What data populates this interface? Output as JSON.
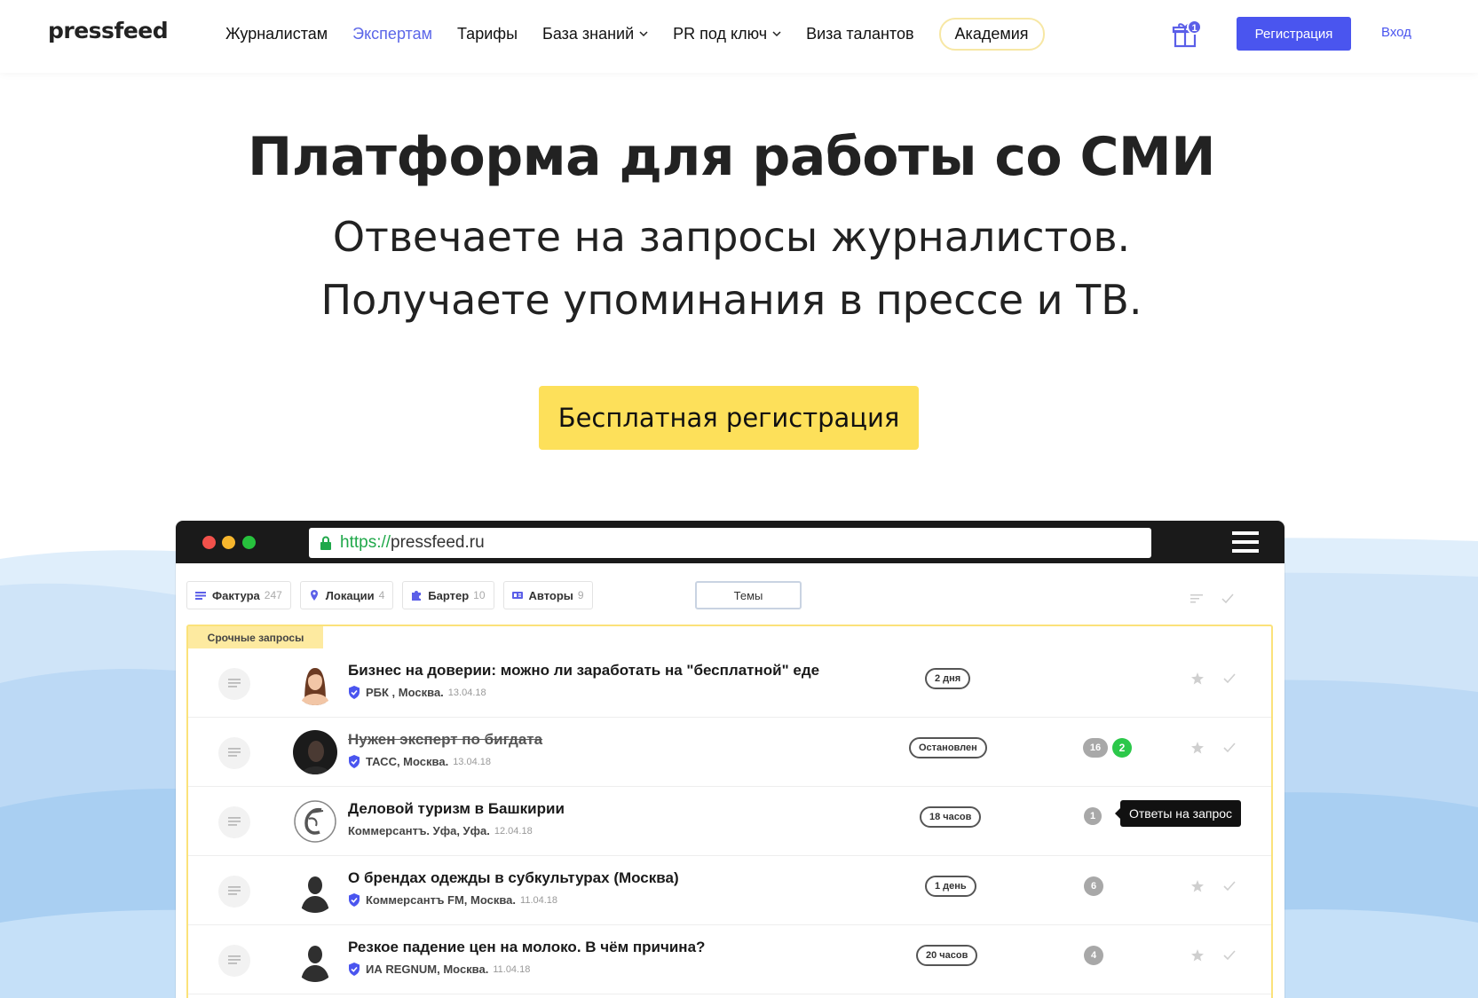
{
  "header": {
    "logo": "pressfeed",
    "nav": [
      {
        "label": "Журналистам",
        "active": false,
        "dropdown": false
      },
      {
        "label": "Экспертам",
        "active": true,
        "dropdown": false
      },
      {
        "label": "Тарифы",
        "active": false,
        "dropdown": false
      },
      {
        "label": "База знаний",
        "active": false,
        "dropdown": true
      },
      {
        "label": "PR под ключ",
        "active": false,
        "dropdown": true
      },
      {
        "label": "Виза талантов",
        "active": false,
        "dropdown": false
      },
      {
        "label": "Академия",
        "active": false,
        "dropdown": false
      }
    ],
    "gift_badge": "1",
    "register_label": "Регистрация",
    "login_label": "Вход"
  },
  "hero": {
    "title": "Платформа для работы со СМИ",
    "subtitle_line1": "Отвечаете на запросы журналистов.",
    "subtitle_line2": "Получаете упоминания в прессе и ТВ.",
    "cta_label": "Бесплатная регистрация"
  },
  "browser": {
    "url_protocol": "https://",
    "url_host": "pressfeed.ru",
    "filters": [
      {
        "label": "Фактура",
        "count": "247",
        "icon": "list-icon"
      },
      {
        "label": "Локации",
        "count": "4",
        "icon": "location-pin-icon"
      },
      {
        "label": "Бартер",
        "count": "10",
        "icon": "puzzle-icon"
      },
      {
        "label": "Авторы",
        "count": "9",
        "icon": "id-card-icon"
      }
    ],
    "themes_label": "Темы",
    "urgent_label": "Срочные запросы",
    "tooltip": "Ответы на запрос",
    "requests": [
      {
        "title": "Бизнес на доверии: можно ли заработать на \"бесплатной\" еде",
        "source": "РБК , Москва.",
        "date": "13.04.18",
        "deadline": "2 дня",
        "verified": true,
        "stopped": false,
        "answers": "",
        "new_answers": ""
      },
      {
        "title": "Нужен эксперт по бигдата",
        "source": "ТАСС, Москва.",
        "date": "13.04.18",
        "deadline": "Остановлен",
        "verified": true,
        "stopped": true,
        "answers": "16",
        "new_answers": "2"
      },
      {
        "title": "Деловой туризм в Башкирии",
        "source": "Коммерсантъ. Уфа, Уфа.",
        "date": "12.04.18",
        "deadline": "18 часов",
        "verified": false,
        "stopped": false,
        "answers": "1",
        "new_answers": ""
      },
      {
        "title": "О брендах одежды в субкультурах (Москва)",
        "source": "Коммерсантъ FM, Москва.",
        "date": "11.04.18",
        "deadline": "1 день",
        "verified": true,
        "stopped": false,
        "answers": "6",
        "new_answers": ""
      },
      {
        "title": "Резкое падение цен на молоко. В чём причина?",
        "source": "ИА REGNUM, Москва.",
        "date": "11.04.18",
        "deadline": "20 часов",
        "verified": true,
        "stopped": false,
        "answers": "4",
        "new_answers": ""
      }
    ]
  },
  "colors": {
    "accent": "#4a55ef",
    "nav_active": "#5b66e8",
    "cta": "#fde05a",
    "urgent_border": "#fbe27a",
    "green_badge": "#2cc84a"
  }
}
